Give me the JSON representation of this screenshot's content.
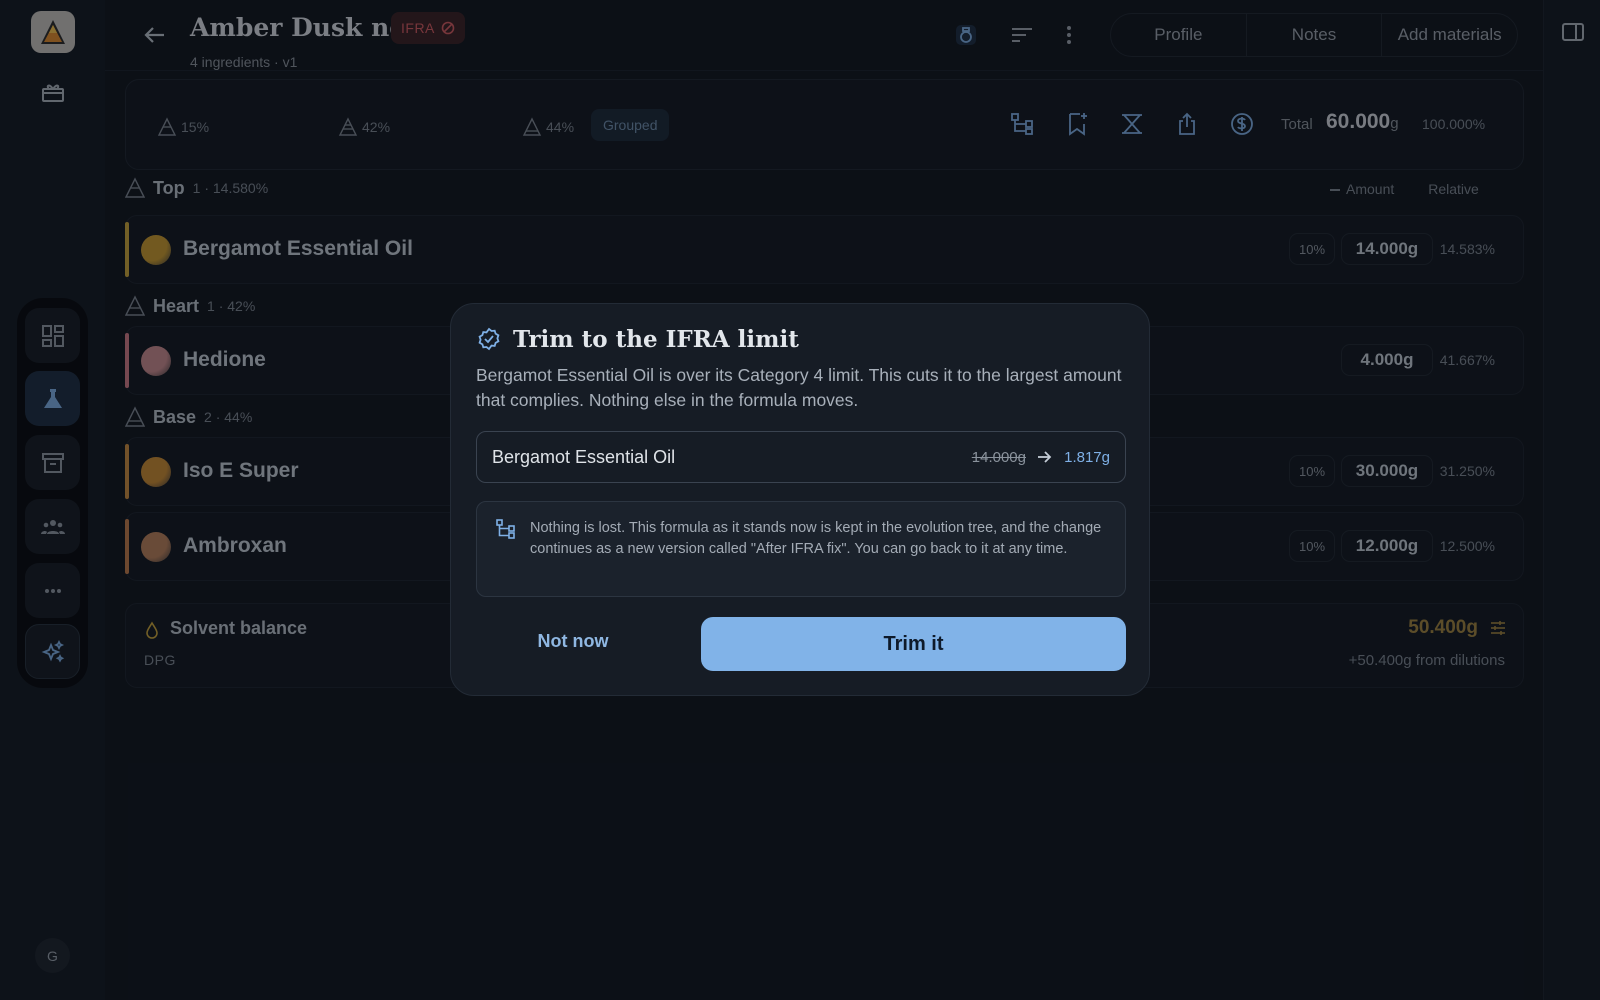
{
  "app": {
    "avatar_initial": "G"
  },
  "header": {
    "title": "Amber Dusk no. 1",
    "ifra_badge": "IFRA",
    "subtitle": "4 ingredients · v1",
    "tabs": [
      {
        "label": "Profile"
      },
      {
        "label": "Notes"
      },
      {
        "label": "Add materials"
      }
    ]
  },
  "summary": {
    "tiers": [
      {
        "pct": "15%"
      },
      {
        "pct": "42%"
      },
      {
        "pct": "44%"
      }
    ],
    "grouped_label": "Grouped",
    "total_label": "Total",
    "total_value": "60.000",
    "total_unit": "g",
    "total_pct": "100.000%"
  },
  "columns": {
    "amount": "Amount",
    "relative": "Relative"
  },
  "sections": [
    {
      "name": "Top",
      "meta": "1 · 14.580%"
    },
    {
      "name": "Heart",
      "meta": "1 · 42%"
    },
    {
      "name": "Base",
      "meta": "2 · 44%"
    }
  ],
  "ingredients": [
    {
      "name": "Bergamot Essential Oil",
      "dilution": "10%",
      "amount": "14.000g",
      "relative": "14.583%",
      "accent": "#c9a43a",
      "dot": "#c99a2e"
    },
    {
      "name": "Hedione",
      "dilution": "",
      "amount": "4.000g",
      "relative": "41.667%",
      "accent": "#d07a86",
      "dot": "#c98a8e"
    },
    {
      "name": "Iso E Super",
      "dilution": "10%",
      "amount": "30.000g",
      "relative": "31.250%",
      "accent": "#c98a3e",
      "dot": "#c98a32"
    },
    {
      "name": "Ambroxan",
      "dilution": "10%",
      "amount": "12.000g",
      "relative": "12.500%",
      "accent": "#c07a4a",
      "dot": "#b9805a"
    }
  ],
  "solvent": {
    "name": "Solvent balance",
    "solvent_type": "DPG",
    "value": "50.400g",
    "from_dilutions": "+50.400g from dilutions"
  },
  "modal": {
    "title": "Trim to the IFRA limit",
    "description": "Bergamot Essential Oil is over its Category 4 limit. This cuts it to the largest amount that complies. Nothing else in the formula moves.",
    "item_name": "Bergamot Essential Oil",
    "old_amount": "14.000g",
    "new_amount": "1.817g",
    "note": "Nothing is lost. This formula as it stands now is kept in the evolution tree, and the change continues as a new version called \"After IFRA fix\". You can go back to it at any time.",
    "cancel_label": "Not now",
    "confirm_label": "Trim it"
  },
  "icons": {
    "logo": "flask-pyramid-logo",
    "rail": [
      "gift-icon",
      "dashboard-icon",
      "flask-icon",
      "archive-icon",
      "team-icon",
      "more-icon",
      "sparkle-icon"
    ],
    "accent_color": "#81b3e8"
  }
}
